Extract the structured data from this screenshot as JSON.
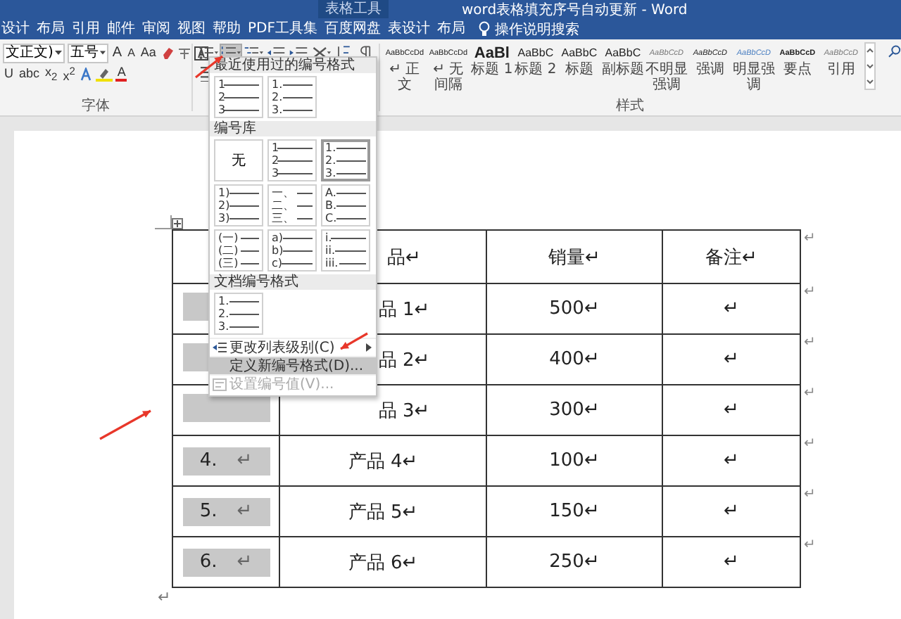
{
  "window": {
    "context_label": "表格工具",
    "title": "word表格填充序号自动更新 - Word"
  },
  "ribbon_tabs": [
    {
      "label": "设计"
    },
    {
      "label": "布局"
    },
    {
      "label": "引用"
    },
    {
      "label": "邮件"
    },
    {
      "label": "审阅"
    },
    {
      "label": "视图"
    },
    {
      "label": "帮助"
    },
    {
      "label": "PDF工具集"
    },
    {
      "label": "百度网盘"
    },
    {
      "label": "表设计"
    },
    {
      "label": "布局"
    }
  ],
  "tell_me": "操作说明搜索",
  "font_group": {
    "font_name": "文正文)",
    "font_size": "五号",
    "row1_buttons": [
      "A",
      "A",
      "Aa"
    ],
    "row2_buttons": [
      "U",
      "abc",
      "x$_{2}$",
      "x$^{2}$"
    ],
    "font_color_button": "A",
    "label": "字体"
  },
  "paragraph_buttons": [
    {
      "kind": "bullets",
      "pressed": false
    },
    {
      "kind": "numbering",
      "pressed": true
    },
    {
      "kind": "multilevel",
      "pressed": false
    },
    {
      "kind": "outdent",
      "pressed": false
    },
    {
      "kind": "indent",
      "pressed": false
    },
    {
      "kind": "layout",
      "pressed": false
    },
    {
      "kind": "sort",
      "pressed": false
    },
    {
      "kind": "marks",
      "pressed": false
    }
  ],
  "styles": {
    "label": "样式",
    "items": [
      {
        "preview": "AaBbCcDd",
        "label": "↵ 正文",
        "kind": "normal"
      },
      {
        "preview": "AaBbCcDd",
        "label": "↵ 无间隔",
        "kind": "normal"
      },
      {
        "preview": "AaBl",
        "label": "标题 1",
        "kind": "heading1"
      },
      {
        "preview": "AaBbC",
        "label": "标题 2",
        "kind": "heading2"
      },
      {
        "preview": "AaBbC",
        "label": "标题",
        "kind": "heading2"
      },
      {
        "preview": "AaBbC",
        "label": "副标题",
        "kind": "heading2"
      },
      {
        "preview": "AaBbCcD",
        "label": "不明显强调",
        "kind": "subtle"
      },
      {
        "preview": "AaBbCcD",
        "label": "强调",
        "kind": "emphasis"
      },
      {
        "preview": "AaBbCcD",
        "label": "明显强调",
        "kind": "intense"
      },
      {
        "preview": "AaBbCcD",
        "label": "要点",
        "kind": "strong"
      },
      {
        "preview": "AaBbCcD",
        "label": "引用",
        "kind": "subtle"
      }
    ]
  },
  "numbering_menu": {
    "sections": [
      {
        "title": "最近使用过的编号格式",
        "formats": [
          {
            "kind": "list",
            "markers": [
              "1",
              "2",
              "3"
            ],
            "selected": false
          },
          {
            "kind": "list",
            "markers": [
              "1.",
              "2.",
              "3."
            ],
            "selected": false
          }
        ]
      },
      {
        "title": "编号库",
        "formats": [
          {
            "kind": "none",
            "label": "无",
            "selected": false
          },
          {
            "kind": "list",
            "markers": [
              "1",
              "2",
              "3"
            ],
            "selected": false
          },
          {
            "kind": "list",
            "markers": [
              "1.",
              "2.",
              "3."
            ],
            "selected": true
          },
          {
            "kind": "list",
            "markers": [
              "1)",
              "2)",
              "3)"
            ],
            "selected": false
          },
          {
            "kind": "list",
            "markers": [
              "一、",
              "二、",
              "三、"
            ],
            "selected": false
          },
          {
            "kind": "list",
            "markers": [
              "A.",
              "B.",
              "C."
            ],
            "selected": false
          },
          {
            "kind": "list",
            "markers": [
              "(一)",
              "(二)",
              "(三)"
            ],
            "selected": false
          },
          {
            "kind": "list",
            "markers": [
              "a)",
              "b)",
              "c)"
            ],
            "selected": false
          },
          {
            "kind": "list",
            "markers": [
              "i.",
              "ii.",
              "iii."
            ],
            "selected": false
          }
        ]
      },
      {
        "title": "文档编号格式",
        "formats": [
          {
            "kind": "list",
            "markers": [
              "1.",
              "2.",
              "3."
            ],
            "selected": false
          }
        ]
      }
    ],
    "items": [
      {
        "label": "更改列表级别(C)",
        "kind": "level",
        "submenu": true,
        "highlighted": false,
        "disabled": false
      },
      {
        "label": "定义新编号格式(D)...",
        "kind": "define",
        "submenu": false,
        "highlighted": true,
        "disabled": false
      },
      {
        "label": "设置编号值(V)...",
        "kind": "value",
        "submenu": false,
        "highlighted": false,
        "disabled": true
      }
    ]
  },
  "table": {
    "header": {
      "cells": [
        "品↵",
        "销量↵",
        "备注↵"
      ],
      "end_mark": "↵"
    },
    "rows": [
      {
        "cells": [
          "品 1↵",
          "500↵",
          "↵"
        ],
        "end_mark": "↵"
      },
      {
        "cells": [
          "品 2↵",
          "400↵",
          "↵"
        ],
        "end_mark": "↵"
      },
      {
        "cells": [
          "品 3↵",
          "300↵",
          "↵"
        ],
        "end_mark": "↵"
      },
      {
        "number": "4.",
        "number_mark": "↵",
        "cells": [
          "产品 4↵",
          "100↵",
          "↵"
        ],
        "end_mark": "↵"
      },
      {
        "number": "5.",
        "number_mark": "↵",
        "cells": [
          "产品 5↵",
          "150↵",
          "↵"
        ],
        "end_mark": "↵"
      },
      {
        "number": "6.",
        "number_mark": "↵",
        "cells": [
          "产品 6↵",
          "250↵",
          "↵"
        ],
        "end_mark": "↵"
      }
    ]
  },
  "after_table_mark": "↵"
}
